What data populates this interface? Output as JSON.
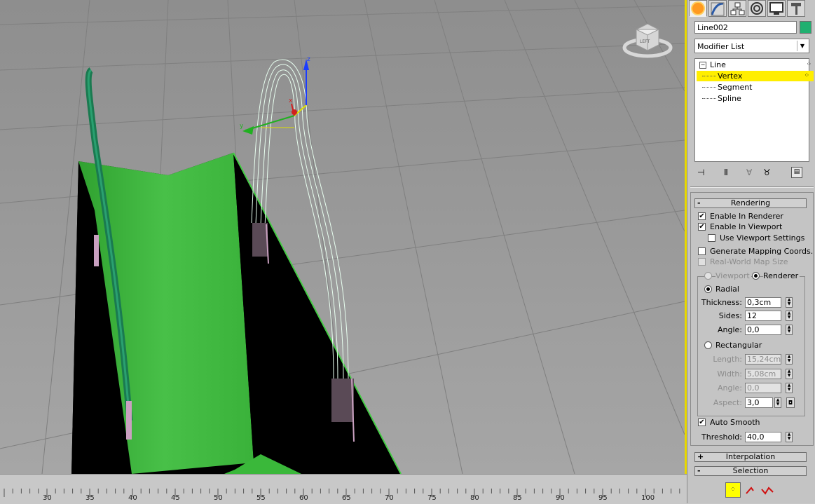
{
  "object": {
    "name": "Line002",
    "color": "#20b070"
  },
  "modifier_list": {
    "label": "Modifier List"
  },
  "stack": {
    "root": "Line",
    "items": [
      "Vertex",
      "Segment",
      "Spline"
    ],
    "selected": "Vertex"
  },
  "rollouts": {
    "rendering": {
      "title": "Rendering",
      "enable_in_renderer": "Enable In Renderer",
      "enable_in_viewport": "Enable In Viewport",
      "use_viewport_settings": "Use Viewport Settings",
      "generate_mapping": "Generate Mapping Coords.",
      "real_world_map": "Real-World Map Size",
      "viewport": "Viewport",
      "renderer": "Renderer",
      "radial": "Radial",
      "thickness_label": "Thickness:",
      "thickness": "0,3cm",
      "sides_label": "Sides:",
      "sides": "12",
      "angle_label": "Angle:",
      "angle": "0,0",
      "rectangular": "Rectangular",
      "length_label": "Length:",
      "length": "15,24cm",
      "width_label": "Width:",
      "width": "5,08cm",
      "rect_angle_label": "Angle:",
      "rect_angle": "0,0",
      "aspect_label": "Aspect:",
      "aspect": "3,0",
      "auto_smooth": "Auto Smooth",
      "threshold_label": "Threshold:",
      "threshold": "40,0"
    },
    "interpolation": {
      "title": "Interpolation"
    },
    "selection": {
      "title": "Selection"
    }
  },
  "viewcube": {
    "face": "LEFT"
  },
  "gizmo": {
    "x": "x",
    "y": "y",
    "z": "z"
  },
  "timeline": {
    "ticks": [
      "30",
      "35",
      "40",
      "45",
      "50",
      "55",
      "60",
      "65",
      "70",
      "75",
      "80",
      "85",
      "90",
      "95",
      "100"
    ]
  },
  "colors": {
    "viewport_bg": "#9a9a9a",
    "bag_green": "#3cb83c",
    "handle_green": "#1f8a5a",
    "selection_yellow": "#ffff00"
  }
}
